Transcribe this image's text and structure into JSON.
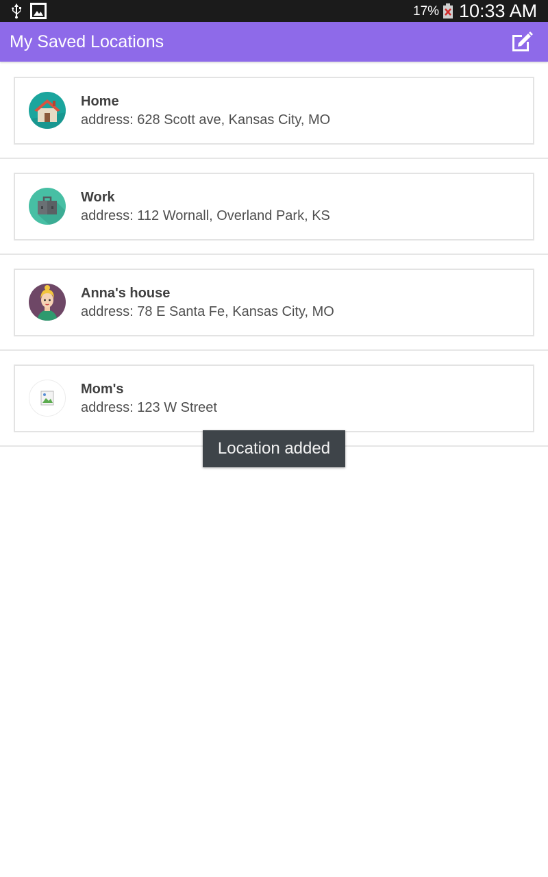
{
  "status_bar": {
    "battery_percent": "17%",
    "time": "10:33 AM",
    "icons": [
      "usb-icon",
      "gallery-icon",
      "battery-alert-icon"
    ]
  },
  "app_bar": {
    "title": "My Saved Locations",
    "edit_icon": "edit-icon",
    "color": "#8e6ae9"
  },
  "locations": [
    {
      "name": "Home",
      "address": "address: 628 Scott ave, Kansas City, MO",
      "icon": "home-icon"
    },
    {
      "name": "Work",
      "address": "address: 112 Wornall, Overland Park, KS",
      "icon": "briefcase-icon"
    },
    {
      "name": "Anna's house",
      "address": "address: 78 E Santa Fe, Kansas City, MO",
      "icon": "person-avatar-icon"
    },
    {
      "name": "Mom's",
      "address": "address: 123 W Street",
      "icon": "broken-image-icon"
    }
  ],
  "toast": {
    "text": "Location added"
  }
}
